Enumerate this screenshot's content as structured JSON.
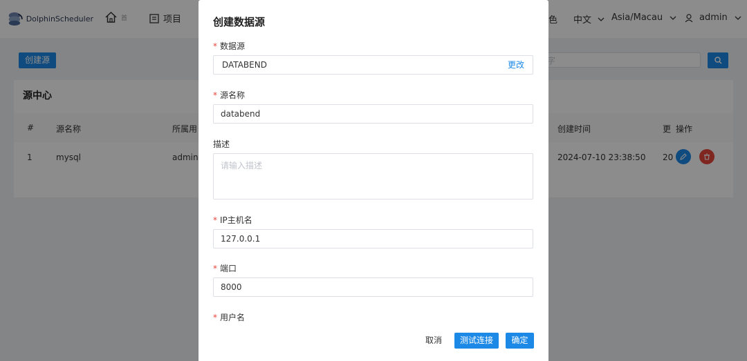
{
  "header": {
    "logo_text": "DolphinScheduler",
    "nav": {
      "home_label": "首",
      "project_label": "项目"
    },
    "role_label": "色",
    "language": "中文",
    "timezone": "Asia/Macau",
    "user": "admin"
  },
  "toolbar": {
    "create_label": "创建源",
    "search_placeholder": "字"
  },
  "card": {
    "title": "源中心",
    "columns": [
      "#",
      "源名称",
      "所属用",
      "创建时间",
      "更",
      "操作"
    ],
    "rows": [
      {
        "index": "1",
        "name": "mysql",
        "owner": "admin",
        "create_time": "2024-07-10 23:38:50",
        "update": "20"
      }
    ]
  },
  "modal": {
    "title": "创建数据源",
    "fields": {
      "datasource": {
        "label": "数据源",
        "value": "DATABEND",
        "change_label": "更改"
      },
      "name": {
        "label": "源名称",
        "value": "databend"
      },
      "description": {
        "label": "描述",
        "placeholder": "请输入描述"
      },
      "host": {
        "label": "IP主机名",
        "value": "127.0.0.1"
      },
      "port": {
        "label": "端口",
        "value": "8000"
      },
      "username": {
        "label": "用户名"
      }
    },
    "buttons": {
      "cancel": "取消",
      "test": "测试连接",
      "confirm": "确定"
    }
  },
  "colors": {
    "primary": "#1c89e7",
    "danger": "#e8453c"
  }
}
